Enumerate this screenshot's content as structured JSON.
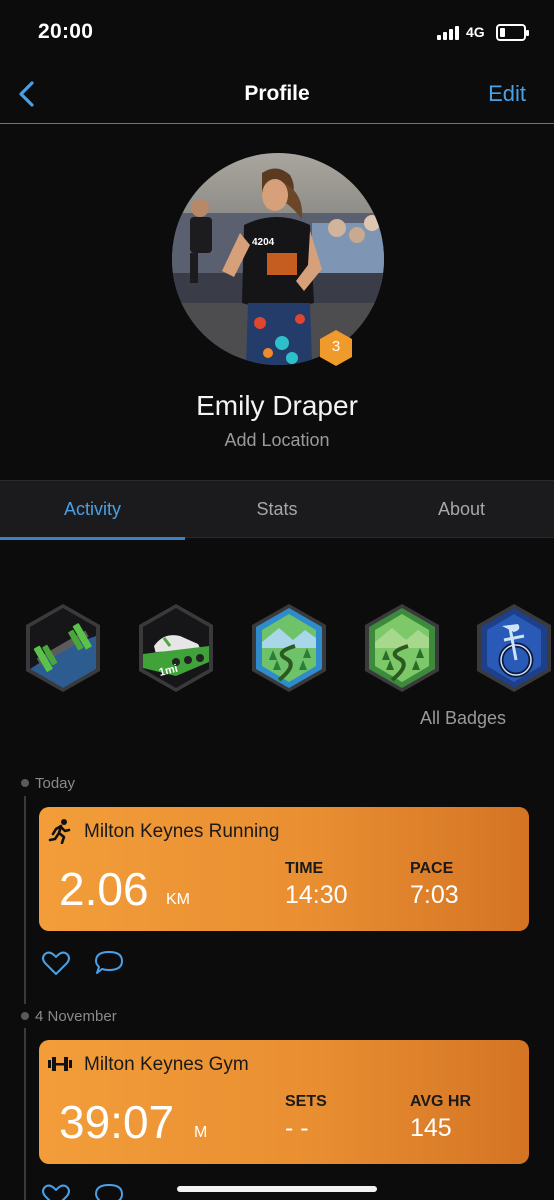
{
  "status": {
    "time": "20:00",
    "network": "4G"
  },
  "nav": {
    "title": "Profile",
    "edit_label": "Edit"
  },
  "profile": {
    "name": "Emily Draper",
    "location_label": "Add Location",
    "level": "3",
    "photo_bib": "4204"
  },
  "tabs": [
    {
      "label": "Activity",
      "active": true
    },
    {
      "label": "Stats",
      "active": false
    },
    {
      "label": "About",
      "active": false
    }
  ],
  "badges": {
    "items": [
      {
        "name": "strength-badge"
      },
      {
        "name": "one-mile-badge",
        "text": "1mi"
      },
      {
        "name": "trail-badge-blue"
      },
      {
        "name": "trail-badge-green"
      },
      {
        "name": "cycling-badge"
      }
    ],
    "all_label": "All Badges"
  },
  "timeline": [
    {
      "date": "Today",
      "title": "Milton Keynes Running",
      "main_value": "2.06",
      "main_unit": "KM",
      "stat1_label": "TIME",
      "stat1_value": "14:30",
      "stat2_label": "PACE",
      "stat2_value": "7:03"
    },
    {
      "date": "4 November",
      "title": "Milton Keynes Gym",
      "main_value": "39:07",
      "main_unit": "M",
      "stat1_label": "SETS",
      "stat1_value": "- -",
      "stat2_label": "AVG HR",
      "stat2_value": "145"
    }
  ],
  "colors": {
    "accent": "#4aa0e6",
    "card": "#ea9234",
    "background": "#0c0c0d"
  }
}
